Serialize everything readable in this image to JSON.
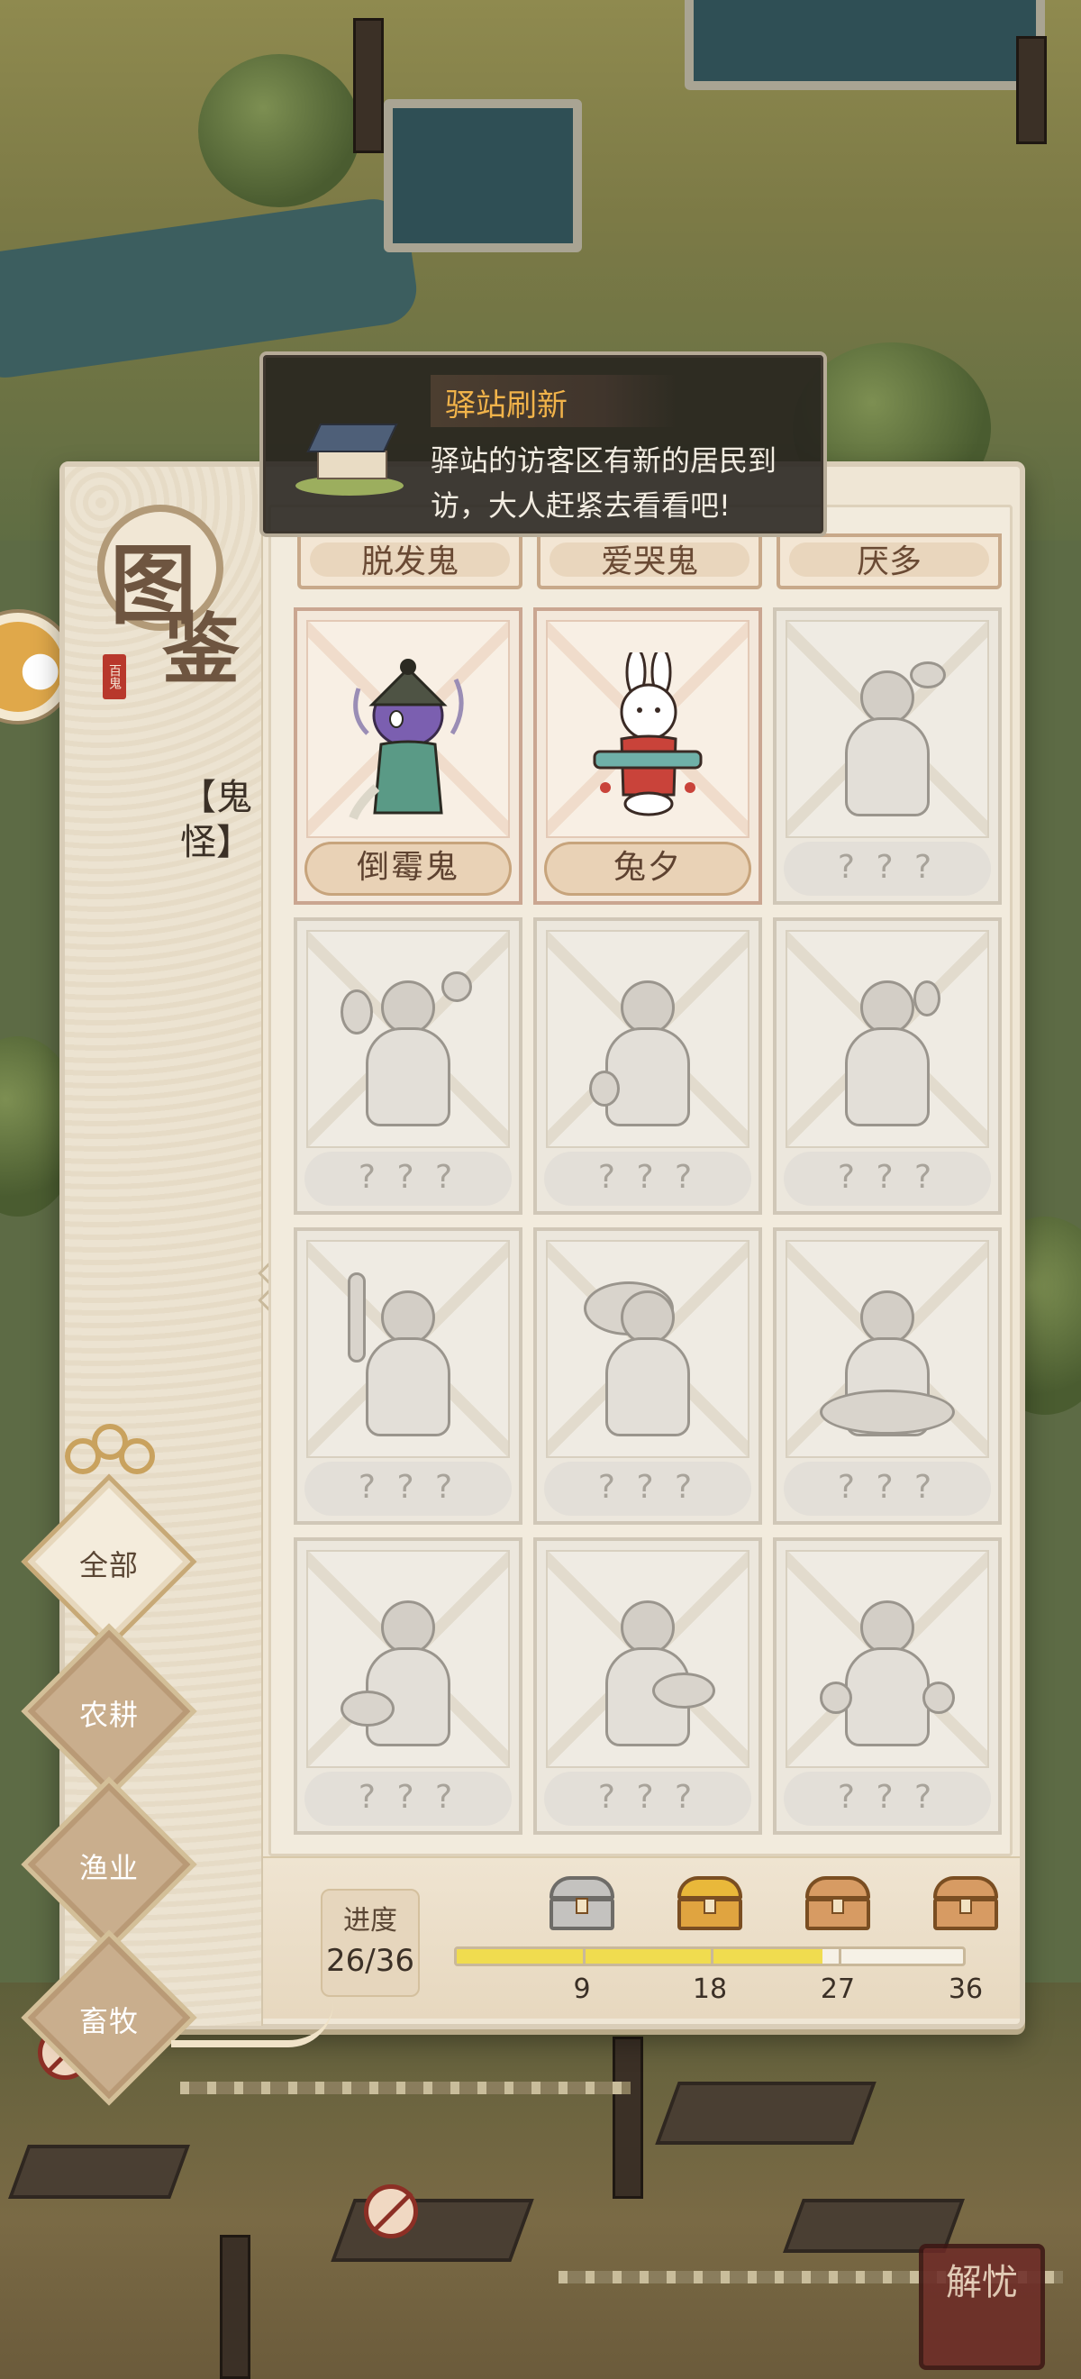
{
  "notification": {
    "title": "驿站刷新",
    "message": "驿站的访客区有新的居民到访，大人赶紧去看看吧!"
  },
  "book": {
    "title_chars": [
      "图",
      "鉴"
    ],
    "seal_text": "百鬼",
    "category_label": "【鬼怪】"
  },
  "menu": {
    "items": [
      {
        "label": "全部",
        "active": true
      },
      {
        "label": "农耕",
        "active": false
      },
      {
        "label": "渔业",
        "active": false
      },
      {
        "label": "畜牧",
        "active": false
      }
    ]
  },
  "top_row_names": [
    "脱发鬼",
    "爱哭鬼",
    "厌多"
  ],
  "cards": [
    {
      "name": "倒霉鬼",
      "owned": true
    },
    {
      "name": "兔夕",
      "owned": true
    },
    {
      "name": "? ? ?",
      "owned": false
    },
    {
      "name": "? ? ?",
      "owned": false
    },
    {
      "name": "? ? ?",
      "owned": false
    },
    {
      "name": "? ? ?",
      "owned": false
    },
    {
      "name": "? ? ?",
      "owned": false
    },
    {
      "name": "? ? ?",
      "owned": false
    },
    {
      "name": "? ? ?",
      "owned": false
    },
    {
      "name": "? ? ?",
      "owned": false
    },
    {
      "name": "? ? ?",
      "owned": false
    },
    {
      "name": "? ? ?",
      "owned": false
    }
  ],
  "progress": {
    "label": "进度",
    "count_text": "26/36",
    "current": 26,
    "total": 36,
    "milestones": [
      {
        "value": 9,
        "label": "9",
        "chest": "opened"
      },
      {
        "value": 18,
        "label": "18",
        "chest": "gold"
      },
      {
        "value": 27,
        "label": "27",
        "chest": "closed"
      },
      {
        "value": 36,
        "label": "36",
        "chest": "closed"
      }
    ]
  },
  "corner_badge": "解忧",
  "colors": {
    "progress_fill": "#f0dc4f",
    "toast_title": "#f1b34a",
    "owned_border": "#caa691"
  }
}
